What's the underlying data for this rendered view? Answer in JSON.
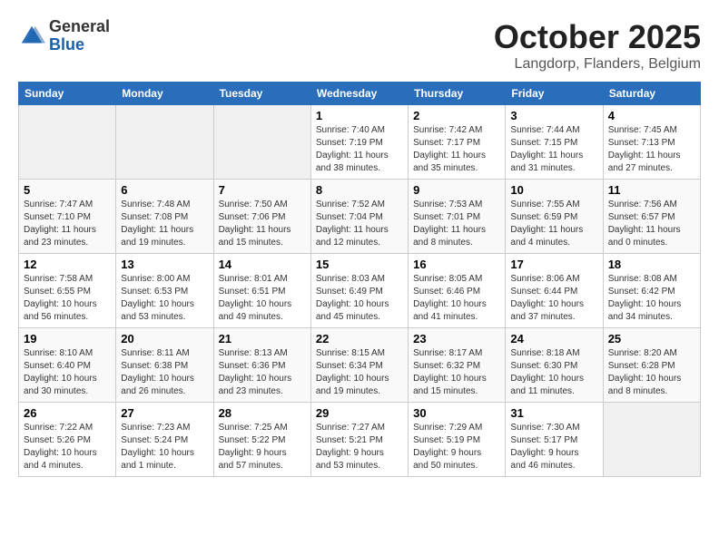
{
  "logo": {
    "general": "General",
    "blue": "Blue"
  },
  "header": {
    "month": "October 2025",
    "location": "Langdorp, Flanders, Belgium"
  },
  "weekdays": [
    "Sunday",
    "Monday",
    "Tuesday",
    "Wednesday",
    "Thursday",
    "Friday",
    "Saturday"
  ],
  "weeks": [
    [
      {
        "day": "",
        "info": ""
      },
      {
        "day": "",
        "info": ""
      },
      {
        "day": "",
        "info": ""
      },
      {
        "day": "1",
        "info": "Sunrise: 7:40 AM\nSunset: 7:19 PM\nDaylight: 11 hours\nand 38 minutes."
      },
      {
        "day": "2",
        "info": "Sunrise: 7:42 AM\nSunset: 7:17 PM\nDaylight: 11 hours\nand 35 minutes."
      },
      {
        "day": "3",
        "info": "Sunrise: 7:44 AM\nSunset: 7:15 PM\nDaylight: 11 hours\nand 31 minutes."
      },
      {
        "day": "4",
        "info": "Sunrise: 7:45 AM\nSunset: 7:13 PM\nDaylight: 11 hours\nand 27 minutes."
      }
    ],
    [
      {
        "day": "5",
        "info": "Sunrise: 7:47 AM\nSunset: 7:10 PM\nDaylight: 11 hours\nand 23 minutes."
      },
      {
        "day": "6",
        "info": "Sunrise: 7:48 AM\nSunset: 7:08 PM\nDaylight: 11 hours\nand 19 minutes."
      },
      {
        "day": "7",
        "info": "Sunrise: 7:50 AM\nSunset: 7:06 PM\nDaylight: 11 hours\nand 15 minutes."
      },
      {
        "day": "8",
        "info": "Sunrise: 7:52 AM\nSunset: 7:04 PM\nDaylight: 11 hours\nand 12 minutes."
      },
      {
        "day": "9",
        "info": "Sunrise: 7:53 AM\nSunset: 7:01 PM\nDaylight: 11 hours\nand 8 minutes."
      },
      {
        "day": "10",
        "info": "Sunrise: 7:55 AM\nSunset: 6:59 PM\nDaylight: 11 hours\nand 4 minutes."
      },
      {
        "day": "11",
        "info": "Sunrise: 7:56 AM\nSunset: 6:57 PM\nDaylight: 11 hours\nand 0 minutes."
      }
    ],
    [
      {
        "day": "12",
        "info": "Sunrise: 7:58 AM\nSunset: 6:55 PM\nDaylight: 10 hours\nand 56 minutes."
      },
      {
        "day": "13",
        "info": "Sunrise: 8:00 AM\nSunset: 6:53 PM\nDaylight: 10 hours\nand 53 minutes."
      },
      {
        "day": "14",
        "info": "Sunrise: 8:01 AM\nSunset: 6:51 PM\nDaylight: 10 hours\nand 49 minutes."
      },
      {
        "day": "15",
        "info": "Sunrise: 8:03 AM\nSunset: 6:49 PM\nDaylight: 10 hours\nand 45 minutes."
      },
      {
        "day": "16",
        "info": "Sunrise: 8:05 AM\nSunset: 6:46 PM\nDaylight: 10 hours\nand 41 minutes."
      },
      {
        "day": "17",
        "info": "Sunrise: 8:06 AM\nSunset: 6:44 PM\nDaylight: 10 hours\nand 37 minutes."
      },
      {
        "day": "18",
        "info": "Sunrise: 8:08 AM\nSunset: 6:42 PM\nDaylight: 10 hours\nand 34 minutes."
      }
    ],
    [
      {
        "day": "19",
        "info": "Sunrise: 8:10 AM\nSunset: 6:40 PM\nDaylight: 10 hours\nand 30 minutes."
      },
      {
        "day": "20",
        "info": "Sunrise: 8:11 AM\nSunset: 6:38 PM\nDaylight: 10 hours\nand 26 minutes."
      },
      {
        "day": "21",
        "info": "Sunrise: 8:13 AM\nSunset: 6:36 PM\nDaylight: 10 hours\nand 23 minutes."
      },
      {
        "day": "22",
        "info": "Sunrise: 8:15 AM\nSunset: 6:34 PM\nDaylight: 10 hours\nand 19 minutes."
      },
      {
        "day": "23",
        "info": "Sunrise: 8:17 AM\nSunset: 6:32 PM\nDaylight: 10 hours\nand 15 minutes."
      },
      {
        "day": "24",
        "info": "Sunrise: 8:18 AM\nSunset: 6:30 PM\nDaylight: 10 hours\nand 11 minutes."
      },
      {
        "day": "25",
        "info": "Sunrise: 8:20 AM\nSunset: 6:28 PM\nDaylight: 10 hours\nand 8 minutes."
      }
    ],
    [
      {
        "day": "26",
        "info": "Sunrise: 7:22 AM\nSunset: 5:26 PM\nDaylight: 10 hours\nand 4 minutes."
      },
      {
        "day": "27",
        "info": "Sunrise: 7:23 AM\nSunset: 5:24 PM\nDaylight: 10 hours\nand 1 minute."
      },
      {
        "day": "28",
        "info": "Sunrise: 7:25 AM\nSunset: 5:22 PM\nDaylight: 9 hours\nand 57 minutes."
      },
      {
        "day": "29",
        "info": "Sunrise: 7:27 AM\nSunset: 5:21 PM\nDaylight: 9 hours\nand 53 minutes."
      },
      {
        "day": "30",
        "info": "Sunrise: 7:29 AM\nSunset: 5:19 PM\nDaylight: 9 hours\nand 50 minutes."
      },
      {
        "day": "31",
        "info": "Sunrise: 7:30 AM\nSunset: 5:17 PM\nDaylight: 9 hours\nand 46 minutes."
      },
      {
        "day": "",
        "info": ""
      }
    ]
  ]
}
